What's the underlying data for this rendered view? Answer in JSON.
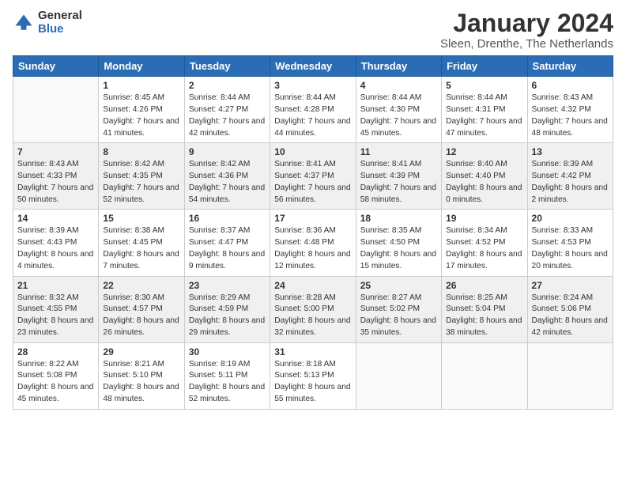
{
  "logo": {
    "general": "General",
    "blue": "Blue"
  },
  "title": "January 2024",
  "subtitle": "Sleen, Drenthe, The Netherlands",
  "days_of_week": [
    "Sunday",
    "Monday",
    "Tuesday",
    "Wednesday",
    "Thursday",
    "Friday",
    "Saturday"
  ],
  "weeks": [
    [
      {
        "day": "",
        "sunrise": "",
        "sunset": "",
        "daylight": "",
        "empty": true
      },
      {
        "day": "1",
        "sunrise": "Sunrise: 8:45 AM",
        "sunset": "Sunset: 4:26 PM",
        "daylight": "Daylight: 7 hours and 41 minutes."
      },
      {
        "day": "2",
        "sunrise": "Sunrise: 8:44 AM",
        "sunset": "Sunset: 4:27 PM",
        "daylight": "Daylight: 7 hours and 42 minutes."
      },
      {
        "day": "3",
        "sunrise": "Sunrise: 8:44 AM",
        "sunset": "Sunset: 4:28 PM",
        "daylight": "Daylight: 7 hours and 44 minutes."
      },
      {
        "day": "4",
        "sunrise": "Sunrise: 8:44 AM",
        "sunset": "Sunset: 4:30 PM",
        "daylight": "Daylight: 7 hours and 45 minutes."
      },
      {
        "day": "5",
        "sunrise": "Sunrise: 8:44 AM",
        "sunset": "Sunset: 4:31 PM",
        "daylight": "Daylight: 7 hours and 47 minutes."
      },
      {
        "day": "6",
        "sunrise": "Sunrise: 8:43 AM",
        "sunset": "Sunset: 4:32 PM",
        "daylight": "Daylight: 7 hours and 48 minutes."
      }
    ],
    [
      {
        "day": "7",
        "sunrise": "Sunrise: 8:43 AM",
        "sunset": "Sunset: 4:33 PM",
        "daylight": "Daylight: 7 hours and 50 minutes."
      },
      {
        "day": "8",
        "sunrise": "Sunrise: 8:42 AM",
        "sunset": "Sunset: 4:35 PM",
        "daylight": "Daylight: 7 hours and 52 minutes."
      },
      {
        "day": "9",
        "sunrise": "Sunrise: 8:42 AM",
        "sunset": "Sunset: 4:36 PM",
        "daylight": "Daylight: 7 hours and 54 minutes."
      },
      {
        "day": "10",
        "sunrise": "Sunrise: 8:41 AM",
        "sunset": "Sunset: 4:37 PM",
        "daylight": "Daylight: 7 hours and 56 minutes."
      },
      {
        "day": "11",
        "sunrise": "Sunrise: 8:41 AM",
        "sunset": "Sunset: 4:39 PM",
        "daylight": "Daylight: 7 hours and 58 minutes."
      },
      {
        "day": "12",
        "sunrise": "Sunrise: 8:40 AM",
        "sunset": "Sunset: 4:40 PM",
        "daylight": "Daylight: 8 hours and 0 minutes."
      },
      {
        "day": "13",
        "sunrise": "Sunrise: 8:39 AM",
        "sunset": "Sunset: 4:42 PM",
        "daylight": "Daylight: 8 hours and 2 minutes."
      }
    ],
    [
      {
        "day": "14",
        "sunrise": "Sunrise: 8:39 AM",
        "sunset": "Sunset: 4:43 PM",
        "daylight": "Daylight: 8 hours and 4 minutes."
      },
      {
        "day": "15",
        "sunrise": "Sunrise: 8:38 AM",
        "sunset": "Sunset: 4:45 PM",
        "daylight": "Daylight: 8 hours and 7 minutes."
      },
      {
        "day": "16",
        "sunrise": "Sunrise: 8:37 AM",
        "sunset": "Sunset: 4:47 PM",
        "daylight": "Daylight: 8 hours and 9 minutes."
      },
      {
        "day": "17",
        "sunrise": "Sunrise: 8:36 AM",
        "sunset": "Sunset: 4:48 PM",
        "daylight": "Daylight: 8 hours and 12 minutes."
      },
      {
        "day": "18",
        "sunrise": "Sunrise: 8:35 AM",
        "sunset": "Sunset: 4:50 PM",
        "daylight": "Daylight: 8 hours and 15 minutes."
      },
      {
        "day": "19",
        "sunrise": "Sunrise: 8:34 AM",
        "sunset": "Sunset: 4:52 PM",
        "daylight": "Daylight: 8 hours and 17 minutes."
      },
      {
        "day": "20",
        "sunrise": "Sunrise: 8:33 AM",
        "sunset": "Sunset: 4:53 PM",
        "daylight": "Daylight: 8 hours and 20 minutes."
      }
    ],
    [
      {
        "day": "21",
        "sunrise": "Sunrise: 8:32 AM",
        "sunset": "Sunset: 4:55 PM",
        "daylight": "Daylight: 8 hours and 23 minutes."
      },
      {
        "day": "22",
        "sunrise": "Sunrise: 8:30 AM",
        "sunset": "Sunset: 4:57 PM",
        "daylight": "Daylight: 8 hours and 26 minutes."
      },
      {
        "day": "23",
        "sunrise": "Sunrise: 8:29 AM",
        "sunset": "Sunset: 4:59 PM",
        "daylight": "Daylight: 8 hours and 29 minutes."
      },
      {
        "day": "24",
        "sunrise": "Sunrise: 8:28 AM",
        "sunset": "Sunset: 5:00 PM",
        "daylight": "Daylight: 8 hours and 32 minutes."
      },
      {
        "day": "25",
        "sunrise": "Sunrise: 8:27 AM",
        "sunset": "Sunset: 5:02 PM",
        "daylight": "Daylight: 8 hours and 35 minutes."
      },
      {
        "day": "26",
        "sunrise": "Sunrise: 8:25 AM",
        "sunset": "Sunset: 5:04 PM",
        "daylight": "Daylight: 8 hours and 38 minutes."
      },
      {
        "day": "27",
        "sunrise": "Sunrise: 8:24 AM",
        "sunset": "Sunset: 5:06 PM",
        "daylight": "Daylight: 8 hours and 42 minutes."
      }
    ],
    [
      {
        "day": "28",
        "sunrise": "Sunrise: 8:22 AM",
        "sunset": "Sunset: 5:08 PM",
        "daylight": "Daylight: 8 hours and 45 minutes."
      },
      {
        "day": "29",
        "sunrise": "Sunrise: 8:21 AM",
        "sunset": "Sunset: 5:10 PM",
        "daylight": "Daylight: 8 hours and 48 minutes."
      },
      {
        "day": "30",
        "sunrise": "Sunrise: 8:19 AM",
        "sunset": "Sunset: 5:11 PM",
        "daylight": "Daylight: 8 hours and 52 minutes."
      },
      {
        "day": "31",
        "sunrise": "Sunrise: 8:18 AM",
        "sunset": "Sunset: 5:13 PM",
        "daylight": "Daylight: 8 hours and 55 minutes."
      },
      {
        "day": "",
        "sunrise": "",
        "sunset": "",
        "daylight": "",
        "empty": true
      },
      {
        "day": "",
        "sunrise": "",
        "sunset": "",
        "daylight": "",
        "empty": true
      },
      {
        "day": "",
        "sunrise": "",
        "sunset": "",
        "daylight": "",
        "empty": true
      }
    ]
  ]
}
